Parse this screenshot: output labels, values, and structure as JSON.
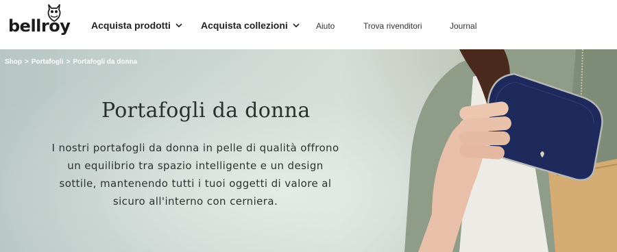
{
  "header": {
    "logo_text": "bellroy",
    "nav": [
      {
        "label": "Acquista prodotti",
        "has_dropdown": true
      },
      {
        "label": "Acquista collezioni",
        "has_dropdown": true
      },
      {
        "label": "Aiuto",
        "has_dropdown": false
      },
      {
        "label": "Trova rivenditori",
        "has_dropdown": false
      },
      {
        "label": "Journal",
        "has_dropdown": false
      }
    ]
  },
  "breadcrumb": {
    "items": [
      "Shop",
      "Portafogli",
      "Portafogli da donna"
    ],
    "separator": ">"
  },
  "hero": {
    "title": "Portafogli da donna",
    "description": "I nostri portafogli da donna in pelle di qualità offrono un equilibrio tra spazio intelligente e un design sottile, mantenendo tutti i tuoi oggetti di valore al sicuro all'interno con cerniera."
  },
  "colors": {
    "wallet": "#1f2a5c",
    "jacket": "#8f9c87",
    "text_dark": "#2b2f2e"
  }
}
